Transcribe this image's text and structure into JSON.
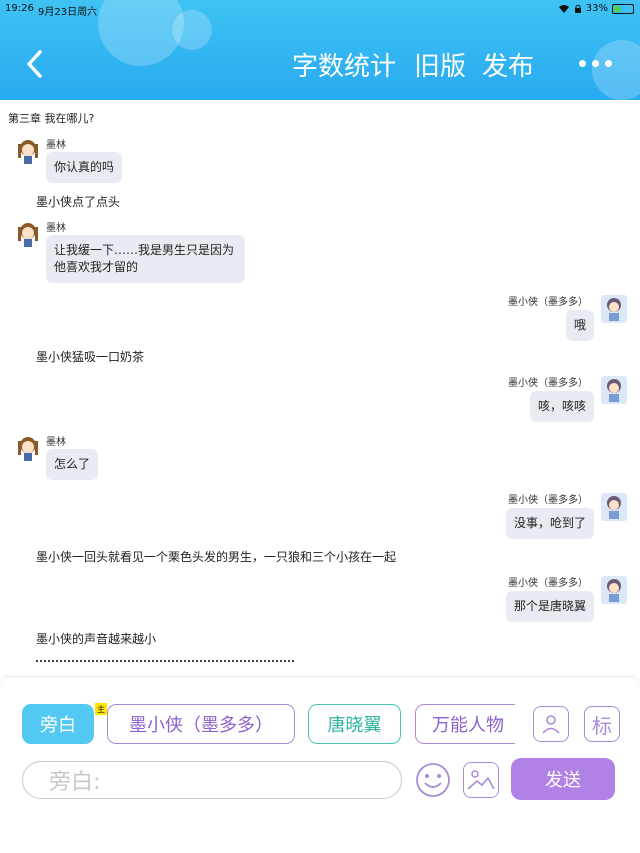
{
  "status_bar": {
    "time": "19:26",
    "date": "9月23日周六",
    "battery": "33%",
    "battery_level": 0.33
  },
  "header": {
    "back_label": "‹",
    "word_count": "字数统计",
    "old_version": "旧版",
    "publish": "发布"
  },
  "chapter_title": "第三章 我在哪儿?",
  "messages": [
    {
      "type": "left",
      "speaker": "墨林",
      "text": "你认真的吗"
    },
    {
      "type": "narration",
      "text": "墨小侠点了点头"
    },
    {
      "type": "left",
      "speaker": "墨林",
      "text": "让我缓一下……我是男生只是因为他喜欢我才留的"
    },
    {
      "type": "right",
      "speaker": "墨小侠（墨多多）",
      "text": "哦"
    },
    {
      "type": "narration",
      "text": "墨小侠猛吸一口奶茶"
    },
    {
      "type": "right",
      "speaker": "墨小侠（墨多多）",
      "text": "咳，咳咳"
    },
    {
      "type": "left",
      "speaker": "墨林",
      "text": "怎么了"
    },
    {
      "type": "right",
      "speaker": "墨小侠（墨多多）",
      "text": "没事，呛到了"
    },
    {
      "type": "narration",
      "text": "墨小侠一回头就看见一个栗色头发的男生，一只狼和三个小孩在一起"
    },
    {
      "type": "right",
      "speaker": "墨小侠（墨多多）",
      "text": "那个是唐晓翼"
    },
    {
      "type": "narration",
      "text": "墨小侠的声音越来越小"
    }
  ],
  "composer": {
    "roles": [
      "旁白",
      "墨小侠（墨多多）",
      "唐晓翼",
      "万能人物"
    ],
    "master_tag": "主",
    "tag_button": "标",
    "input_placeholder": "旁白:",
    "send_label": "发送"
  },
  "colors": {
    "header": "#28aaf0",
    "narration_role": "#52c8f2",
    "purple": "#a98bd8",
    "teal": "#4bc5b4",
    "send": "#b182e6",
    "bubble": "#e8ecf2"
  }
}
